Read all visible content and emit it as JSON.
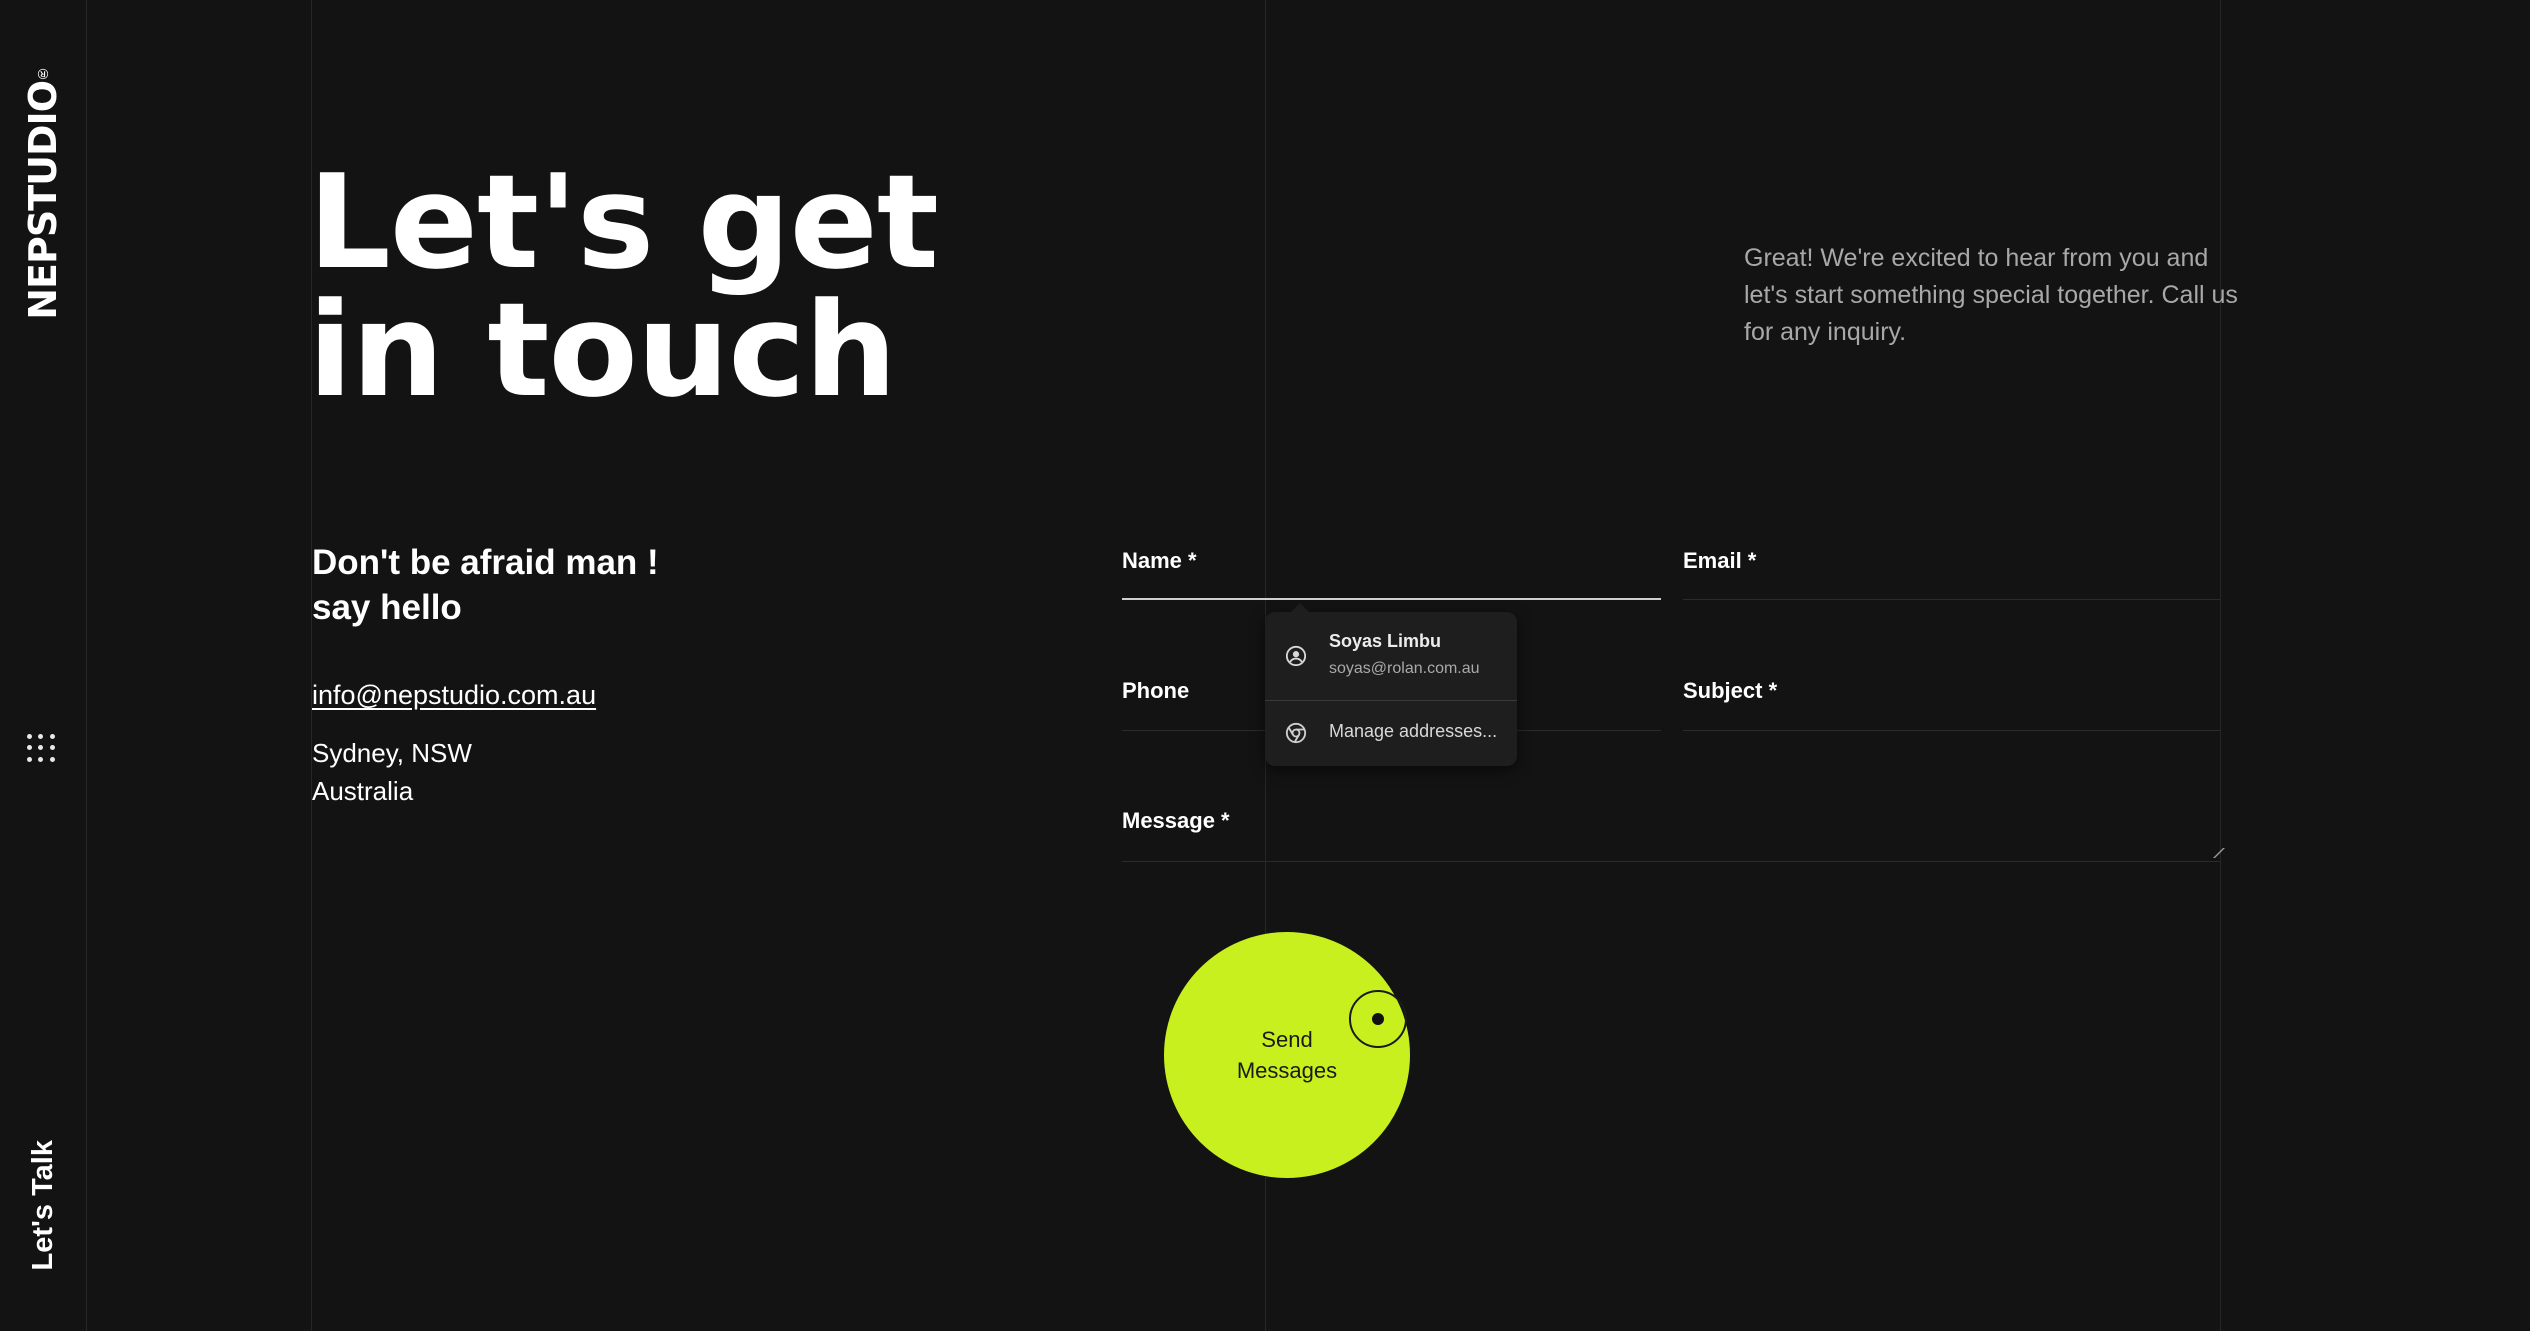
{
  "brand": {
    "name": "NEPSTUDIO",
    "registered": "®"
  },
  "side": {
    "menu_icon": "dots-grid-icon",
    "cta": "Let's Talk"
  },
  "hero": {
    "title": "Let's get in touch",
    "intro": "Great! We're excited to hear from you and let's start something special together. Call us for any inquiry."
  },
  "contact": {
    "heading_line1": "Don't be afraid man !",
    "heading_line2": "say hello",
    "email": "info@nepstudio.com.au",
    "address_line1": "Sydney, NSW",
    "address_line2": "Australia"
  },
  "form": {
    "name_label": "Name *",
    "email_label": "Email *",
    "phone_label": "Phone",
    "subject_label": "Subject *",
    "message_label": "Message *",
    "send_line1": "Send",
    "send_line2": "Messages"
  },
  "autofill": {
    "profile_name": "Soyas Limbu",
    "profile_email": "soyas@rolan.com.au",
    "manage_label": "Manage addresses...",
    "profile_icon": "account-circle-icon",
    "manage_icon": "chrome-icon"
  },
  "colors": {
    "background": "#131313",
    "accent": "#c8f01f",
    "muted_text": "#a8a8a8"
  }
}
